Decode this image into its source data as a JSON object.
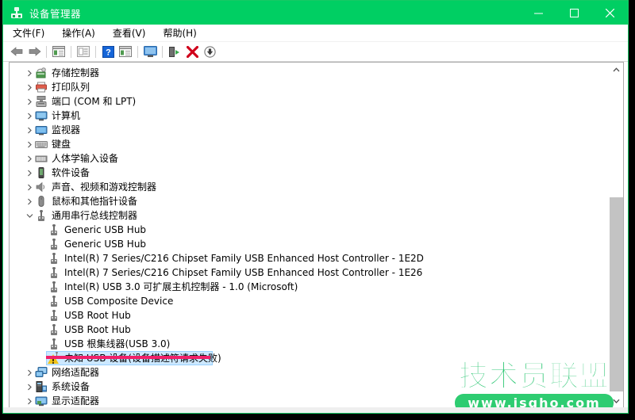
{
  "window": {
    "title": "设备管理器",
    "title_icon": "device-manager-usb-icon",
    "accent_color": "#00cf63",
    "controls": {
      "minimize": "最小化",
      "maximize": "最大化",
      "close": "关闭"
    }
  },
  "menu": {
    "items": [
      {
        "label": "文件(F)",
        "text": "文件",
        "accel": "F"
      },
      {
        "label": "操作(A)",
        "text": "操作",
        "accel": "A"
      },
      {
        "label": "查看(V)",
        "text": "查看",
        "accel": "V"
      },
      {
        "label": "帮助(H)",
        "text": "帮助",
        "accel": "H"
      }
    ]
  },
  "toolbar": {
    "buttons": [
      {
        "name": "back-arrow-icon",
        "tip": "后退"
      },
      {
        "name": "forward-arrow-icon",
        "tip": "前进"
      },
      {
        "name": "show-hide-console-tree-icon",
        "tip": "显示/隐藏控制台树"
      },
      {
        "name": "properties-icon",
        "tip": "属性"
      },
      {
        "name": "help-icon",
        "tip": "帮助"
      },
      {
        "name": "details-view-icon",
        "tip": "详细信息"
      },
      {
        "name": "scan-hardware-changes-icon",
        "tip": "扫描检测硬件改动"
      },
      {
        "name": "enable-device-icon",
        "tip": "启用设备"
      },
      {
        "name": "uninstall-device-icon",
        "tip": "卸载设备"
      },
      {
        "name": "update-driver-icon",
        "tip": "更新驱动程序"
      }
    ]
  },
  "tree": {
    "nodes": [
      {
        "label": "存储控制器",
        "icon": "storage-controller-icon",
        "indent": 0,
        "state": "collapsed",
        "selected": false
      },
      {
        "label": "打印队列",
        "icon": "print-queue-icon",
        "indent": 0,
        "state": "collapsed",
        "selected": false
      },
      {
        "label": "端口 (COM 和 LPT)",
        "icon": "port-icon",
        "indent": 0,
        "state": "collapsed",
        "selected": false
      },
      {
        "label": "计算机",
        "icon": "computer-icon",
        "indent": 0,
        "state": "collapsed",
        "selected": false
      },
      {
        "label": "监视器",
        "icon": "monitor-icon",
        "indent": 0,
        "state": "collapsed",
        "selected": false
      },
      {
        "label": "键盘",
        "icon": "keyboard-icon",
        "indent": 0,
        "state": "collapsed",
        "selected": false
      },
      {
        "label": "人体学输入设备",
        "icon": "hid-icon",
        "indent": 0,
        "state": "collapsed",
        "selected": false
      },
      {
        "label": "软件设备",
        "icon": "software-device-icon",
        "indent": 0,
        "state": "collapsed",
        "selected": false
      },
      {
        "label": "声音、视频和游戏控制器",
        "icon": "sound-video-game-icon",
        "indent": 0,
        "state": "collapsed",
        "selected": false
      },
      {
        "label": "鼠标和其他指针设备",
        "icon": "mouse-icon",
        "indent": 0,
        "state": "collapsed",
        "selected": false
      },
      {
        "label": "通用串行总线控制器",
        "icon": "usb-controller-icon",
        "indent": 0,
        "state": "expanded",
        "selected": false
      },
      {
        "label": "Generic USB Hub",
        "icon": "usb-icon",
        "indent": 1,
        "state": "leaf",
        "selected": false
      },
      {
        "label": "Generic USB Hub",
        "icon": "usb-icon",
        "indent": 1,
        "state": "leaf",
        "selected": false
      },
      {
        "label": "Intel(R) 7 Series/C216 Chipset Family USB Enhanced Host Controller - 1E2D",
        "icon": "usb-icon",
        "indent": 1,
        "state": "leaf",
        "selected": false
      },
      {
        "label": "Intel(R) 7 Series/C216 Chipset Family USB Enhanced Host Controller - 1E26",
        "icon": "usb-icon",
        "indent": 1,
        "state": "leaf",
        "selected": false
      },
      {
        "label": "Intel(R) USB 3.0 可扩展主机控制器 - 1.0 (Microsoft)",
        "icon": "usb-icon",
        "indent": 1,
        "state": "leaf",
        "selected": false
      },
      {
        "label": "USB Composite Device",
        "icon": "usb-icon",
        "indent": 1,
        "state": "leaf",
        "selected": false
      },
      {
        "label": "USB Root Hub",
        "icon": "usb-icon",
        "indent": 1,
        "state": "leaf",
        "selected": false
      },
      {
        "label": "USB Root Hub",
        "icon": "usb-icon",
        "indent": 1,
        "state": "leaf",
        "selected": false
      },
      {
        "label": "USB 根集线器(USB 3.0)",
        "icon": "usb-icon",
        "indent": 1,
        "state": "leaf",
        "selected": false
      },
      {
        "label": "未知 USB 设备(设备描述符请求失败)",
        "icon": "usb-warning-icon",
        "indent": 1,
        "state": "leaf",
        "selected": true
      },
      {
        "label": "网络适配器",
        "icon": "network-adapter-icon",
        "indent": 0,
        "state": "collapsed",
        "selected": false
      },
      {
        "label": "系统设备",
        "icon": "system-device-icon",
        "indent": 0,
        "state": "collapsed",
        "selected": false
      },
      {
        "label": "显示适配器",
        "icon": "display-adapter-icon",
        "indent": 0,
        "state": "collapsed",
        "selected": false
      }
    ]
  },
  "annotation": {
    "name": "red-underline-highlight",
    "color": "#f0206a",
    "target": "未知 USB 设备(设备描述符请求失败)"
  },
  "scrollbar": {
    "up_arrow": "▲",
    "down_arrow": "▼",
    "orientation": "vertical"
  },
  "watermark": {
    "brand": "技术员联盟",
    "url": "www.jsgho.com",
    "color": "#2ecc71"
  }
}
